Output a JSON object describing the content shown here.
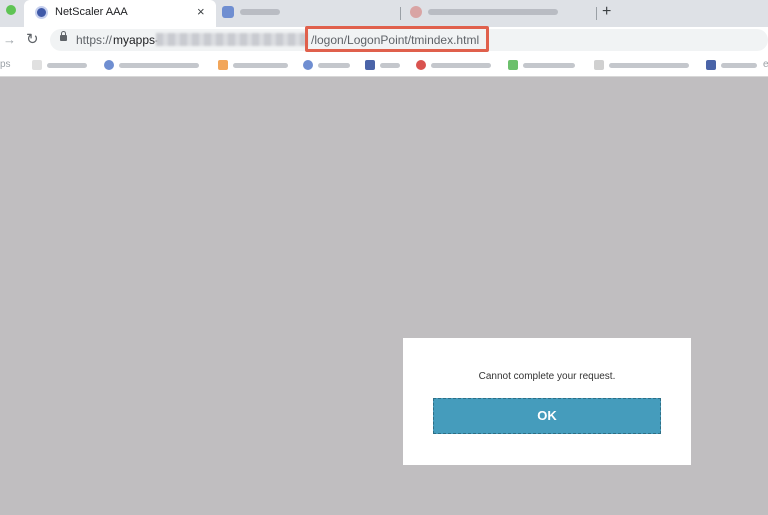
{
  "browser": {
    "active_tab": {
      "title": "NetScaler AAA",
      "favicon": "netscaler-icon",
      "close": "×"
    },
    "new_tab": "+",
    "url": {
      "scheme": "https://",
      "host_visible": "myapps-",
      "path": "/logon/LogonPoint/tmindex.html"
    },
    "highlight_color": "#e0604c"
  },
  "dialog": {
    "message": "Cannot complete your request.",
    "ok_label": "OK",
    "button_color": "#459cbc"
  },
  "colors": {
    "page_background": "#c0bec0",
    "tabstrip": "#dee1e6"
  }
}
